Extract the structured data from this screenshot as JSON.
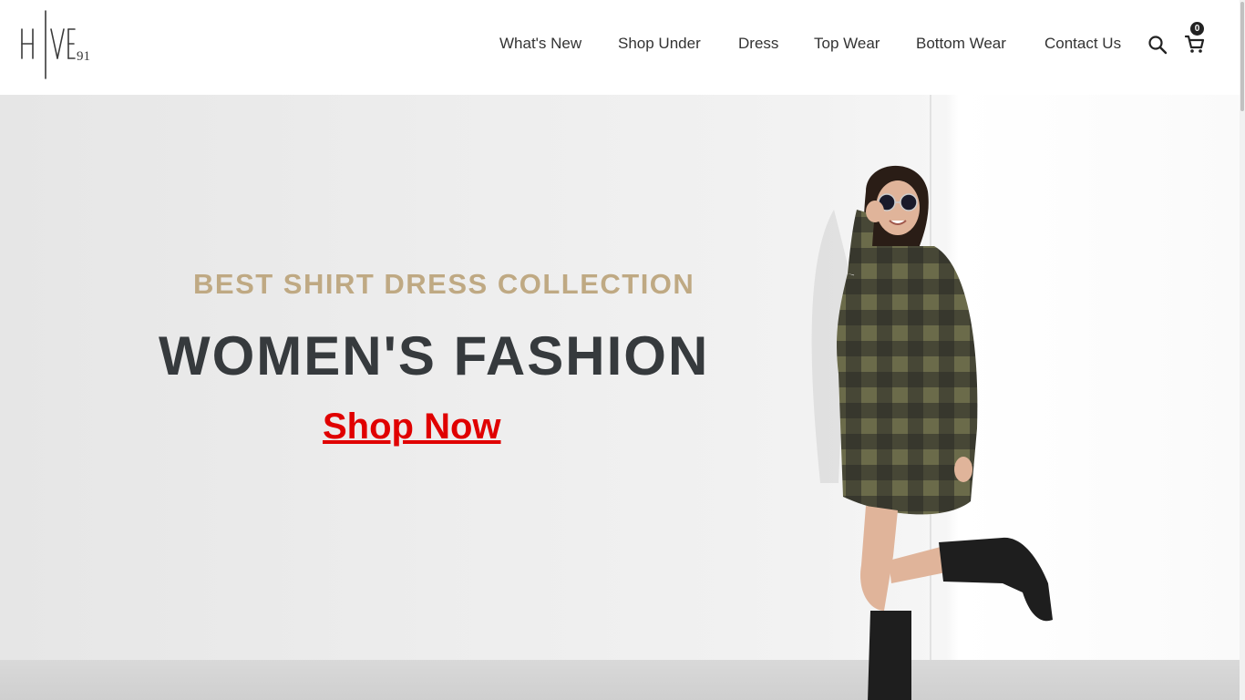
{
  "brand": {
    "logo_text": "HIVE 91"
  },
  "nav": {
    "items": [
      {
        "label": "What's New"
      },
      {
        "label": "Shop Under"
      },
      {
        "label": "Dress"
      },
      {
        "label": "Top Wear"
      },
      {
        "label": "Bottom Wear"
      },
      {
        "label": "Contact Us"
      }
    ]
  },
  "header": {
    "search_icon": "search-icon",
    "cart_icon": "cart-icon",
    "cart_count": "0"
  },
  "hero": {
    "subtitle": "BEST SHIRT DRESS COLLECTION",
    "title": "WOMEN'S FASHION",
    "cta_label": "Shop Now"
  },
  "colors": {
    "subtitle": "#bfa983",
    "title": "#363a3d",
    "cta": "#e00000",
    "nav_text": "#333333"
  }
}
